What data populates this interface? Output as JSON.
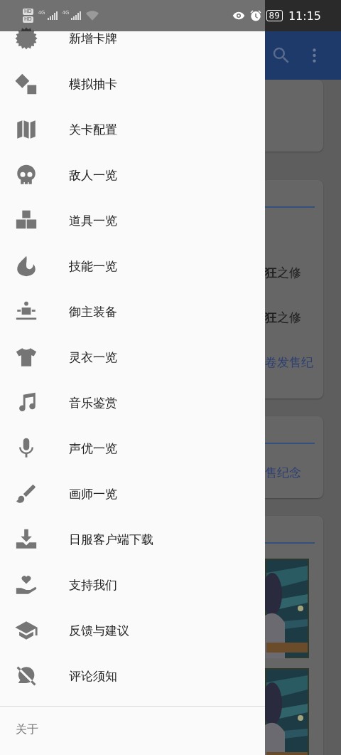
{
  "status_bar": {
    "sims": [
      {
        "hd": "HD",
        "network": "4G"
      },
      {
        "hd": "HD",
        "network": "4G"
      }
    ],
    "battery": "89",
    "time": "11:15"
  },
  "drawer": {
    "items": [
      {
        "label": "新增卡牌"
      },
      {
        "label": "模拟抽卡"
      },
      {
        "label": "关卡配置"
      },
      {
        "label": "敌人一览"
      },
      {
        "label": "道具一览"
      },
      {
        "label": "技能一览"
      },
      {
        "label": "御主装备"
      },
      {
        "label": "灵衣一览"
      },
      {
        "label": "音乐鉴赏"
      },
      {
        "label": "声优一览"
      },
      {
        "label": "画师一览"
      },
      {
        "label": "日服客户端下载"
      },
      {
        "label": "支持我们"
      },
      {
        "label": "反馈与建议"
      },
      {
        "label": "评论须知"
      }
    ],
    "footer": "关于"
  },
  "background": {
    "cards": [
      {
        "kind": "blank"
      },
      {
        "kind": "text",
        "lines": [
          {
            "text": "**狂**之修",
            "link": false
          },
          {
            "text": "**狂**之修",
            "link": false
          },
          {
            "text": "卷发售纪",
            "link": true
          }
        ]
      },
      {
        "kind": "text",
        "lines": [
          {
            "text": "售纪念",
            "link": true
          }
        ]
      },
      {
        "kind": "pictures"
      }
    ]
  }
}
